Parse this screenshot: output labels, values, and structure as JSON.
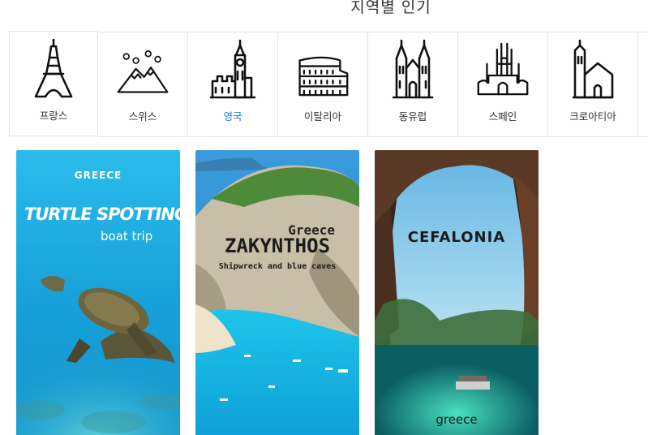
{
  "page": {
    "section_title": "지역별 인기"
  },
  "regions": [
    {
      "label": "프랑스",
      "icon": "eiffel-tower-icon",
      "active": false
    },
    {
      "label": "스위스",
      "icon": "snowy-mountain-icon",
      "active": false
    },
    {
      "label": "영국",
      "icon": "big-ben-icon",
      "active": true
    },
    {
      "label": "이탈리아",
      "icon": "colosseum-icon",
      "active": false
    },
    {
      "label": "동유럽",
      "icon": "gothic-church-icon",
      "active": false
    },
    {
      "label": "스페인",
      "icon": "sagrada-familia-icon",
      "active": false
    },
    {
      "label": "크로아티아",
      "icon": "croatian-church-icon",
      "active": false
    }
  ],
  "cards": [
    {
      "tag": "GREECE",
      "title": "TURTLE SPOTTING",
      "subtitle": "boat trip"
    },
    {
      "tag": "Greece",
      "title": "ZAKYNTHOS",
      "subtitle": "Shipwreck and blue caves"
    },
    {
      "title": "CEFALONIA",
      "subtitle": "greece"
    }
  ],
  "colors": {
    "active_tab": "#1a7fd6",
    "border": "#e3e3e3"
  }
}
